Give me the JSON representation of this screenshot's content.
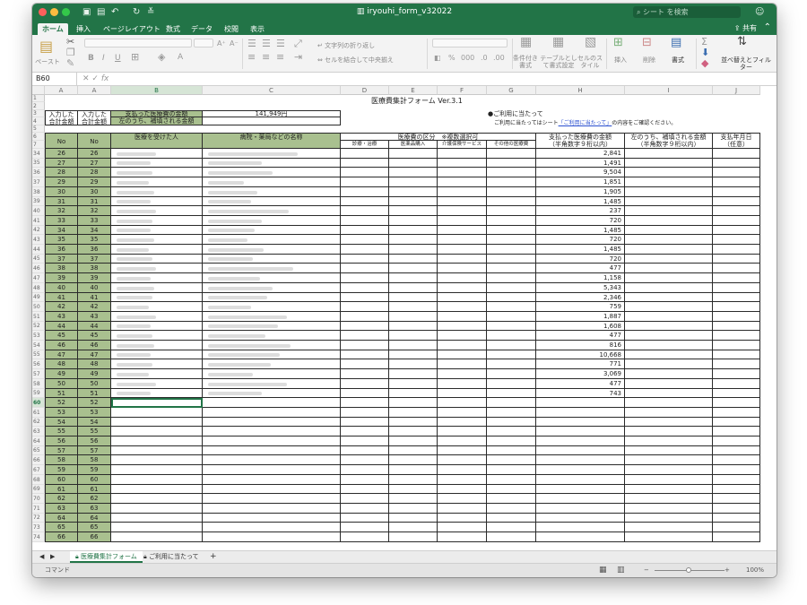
{
  "window": {
    "title": "iryouhi_form_v32022",
    "search_placeholder": "シート を検索",
    "share_label": "共有"
  },
  "ribbon_tabs": [
    "ホーム",
    "挿入",
    "ページレイアウト",
    "数式",
    "データ",
    "校閲",
    "表示"
  ],
  "ribbon": {
    "paste": "ペースト",
    "wrap_text": "文字列の折り返し",
    "merge_center": "セルを結合して中央揃え",
    "conditional_format": "条件付き書式",
    "format_as_table": "テーブルとして書式設定",
    "cell_styles": "セルのスタイル",
    "insert": "挿入",
    "delete": "削除",
    "format": "書式",
    "sort_filter": "並べ替えとフィルター"
  },
  "formula_bar": {
    "name_box": "B60",
    "fx": "fx",
    "content": ""
  },
  "columns": [
    "A",
    "A",
    "B",
    "C",
    "D",
    "E",
    "F",
    "G",
    "H",
    "I",
    "J"
  ],
  "sheet_header": {
    "form_title": "医療費集計フォーム Ver.3.1",
    "input_total_1": "入力した",
    "input_total_2": "合計金額",
    "paid_label": "支払った医療費の金額",
    "paid_value": "141,949円",
    "reimb_label": "左のうち、補填される金額",
    "usage_title": "●ご利用に当たって",
    "usage_text_pre": "ご利用に当たってはシート",
    "usage_link": "「ご利用に当たって」",
    "usage_text_post": "の内容をご確認ください。",
    "col_no": "No",
    "col_person": "医療を受けた人",
    "col_hospital": "病院・薬局などの名称",
    "col_category": "医療費の区分　※複数選択可",
    "sub_cat_1": "診療・治療",
    "sub_cat_2": "医薬品購入",
    "sub_cat_3": "介護保険サービス",
    "sub_cat_4": "その他の医療費",
    "col_paid": "支払った医療費の金額",
    "col_paid_sub": "（半角数字９桁以内）",
    "col_reimb": "左のうち、補填される金額",
    "col_reimb_sub": "（半角数字９桁以内）",
    "col_date": "支払年月日",
    "col_date_sub": "（任意）"
  },
  "rows": [
    {
      "row": "34",
      "no": "26",
      "amount": "2,841"
    },
    {
      "row": "35",
      "no": "27",
      "amount": "1,491"
    },
    {
      "row": "36",
      "no": "28",
      "amount": "9,504"
    },
    {
      "row": "37",
      "no": "29",
      "amount": "1,851"
    },
    {
      "row": "38",
      "no": "30",
      "amount": "1,905"
    },
    {
      "row": "39",
      "no": "31",
      "amount": "1,485"
    },
    {
      "row": "40",
      "no": "32",
      "amount": "237"
    },
    {
      "row": "41",
      "no": "33",
      "amount": "720"
    },
    {
      "row": "42",
      "no": "34",
      "amount": "1,485"
    },
    {
      "row": "43",
      "no": "35",
      "amount": "720"
    },
    {
      "row": "44",
      "no": "36",
      "amount": "1,485"
    },
    {
      "row": "45",
      "no": "37",
      "amount": "720"
    },
    {
      "row": "46",
      "no": "38",
      "amount": "477"
    },
    {
      "row": "47",
      "no": "39",
      "amount": "1,158"
    },
    {
      "row": "48",
      "no": "40",
      "amount": "5,343"
    },
    {
      "row": "49",
      "no": "41",
      "amount": "2,346"
    },
    {
      "row": "50",
      "no": "42",
      "amount": "759"
    },
    {
      "row": "51",
      "no": "43",
      "amount": "1,887"
    },
    {
      "row": "52",
      "no": "44",
      "amount": "1,608"
    },
    {
      "row": "53",
      "no": "45",
      "amount": "477"
    },
    {
      "row": "54",
      "no": "46",
      "amount": "816"
    },
    {
      "row": "55",
      "no": "47",
      "amount": "10,668"
    },
    {
      "row": "56",
      "no": "48",
      "amount": "771"
    },
    {
      "row": "57",
      "no": "49",
      "amount": "3,069"
    },
    {
      "row": "58",
      "no": "50",
      "amount": "477"
    },
    {
      "row": "59",
      "no": "51",
      "amount": "743"
    },
    {
      "row": "60",
      "no": "52",
      "amount": ""
    },
    {
      "row": "61",
      "no": "53",
      "amount": ""
    },
    {
      "row": "62",
      "no": "54",
      "amount": ""
    },
    {
      "row": "63",
      "no": "55",
      "amount": ""
    },
    {
      "row": "64",
      "no": "56",
      "amount": ""
    },
    {
      "row": "65",
      "no": "57",
      "amount": ""
    },
    {
      "row": "66",
      "no": "58",
      "amount": ""
    },
    {
      "row": "67",
      "no": "59",
      "amount": ""
    },
    {
      "row": "68",
      "no": "60",
      "amount": ""
    },
    {
      "row": "69",
      "no": "61",
      "amount": ""
    },
    {
      "row": "70",
      "no": "62",
      "amount": ""
    },
    {
      "row": "71",
      "no": "63",
      "amount": ""
    },
    {
      "row": "72",
      "no": "64",
      "amount": ""
    },
    {
      "row": "73",
      "no": "65",
      "amount": ""
    },
    {
      "row": "74",
      "no": "66",
      "amount": ""
    }
  ],
  "header_rows": [
    "1",
    "2",
    "3",
    "4",
    "5",
    "6",
    "7"
  ],
  "sheet_tabs": [
    "医療費集計フォーム",
    "ご利用に当たって"
  ],
  "status": {
    "mode": "コマンド",
    "zoom": "100%"
  },
  "colors": {
    "excel_green": "#227447",
    "header_fill": "#a9c08f"
  }
}
